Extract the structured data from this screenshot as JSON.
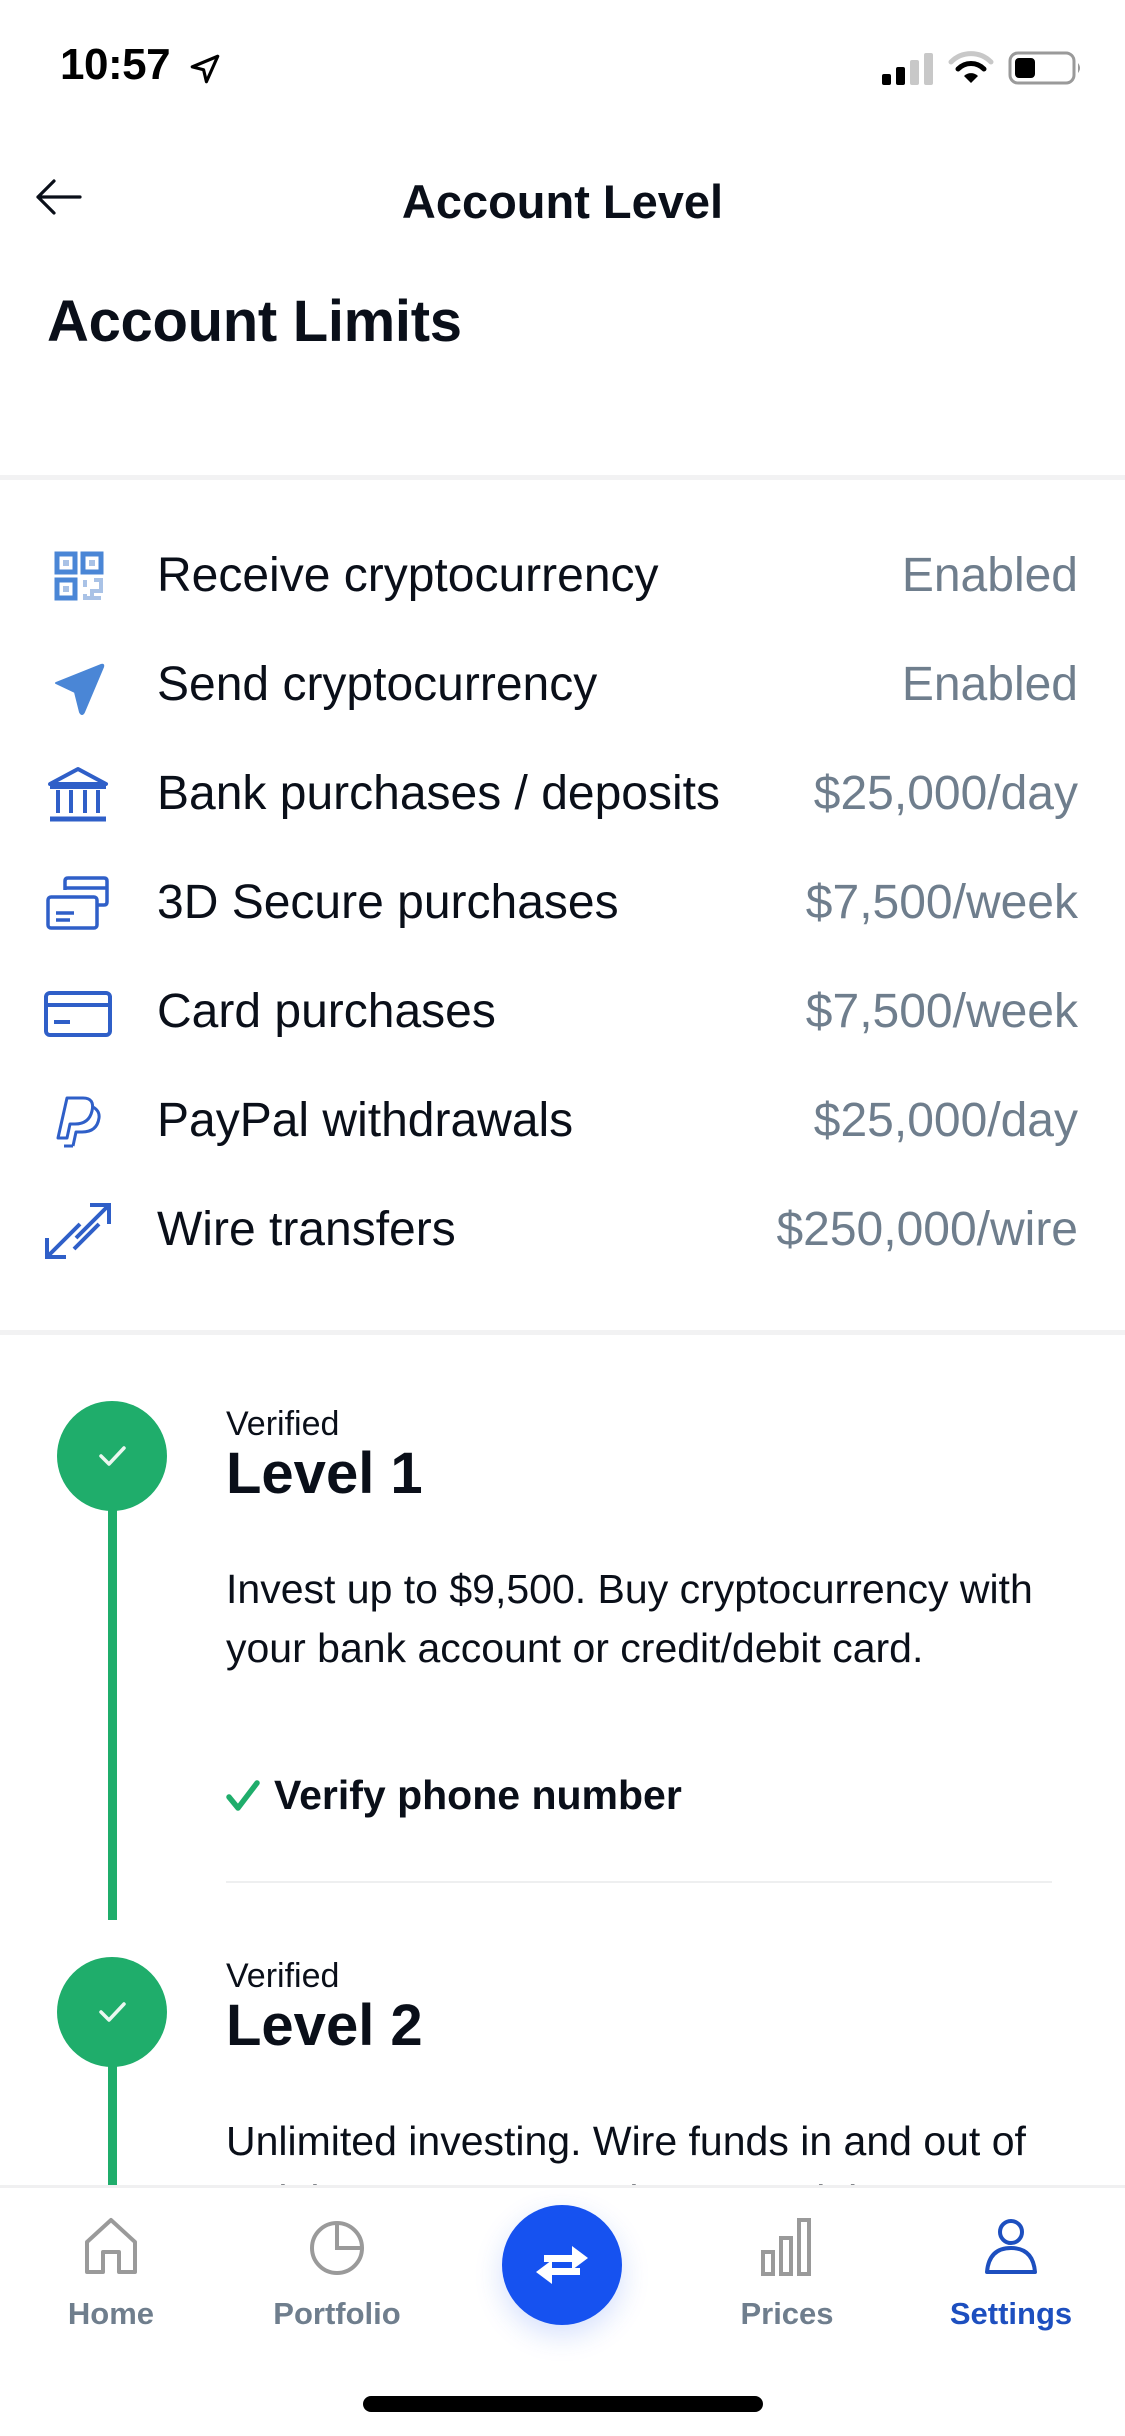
{
  "status_bar": {
    "time": "10:57",
    "signal_bars_active": 2,
    "signal_bars_total": 4,
    "battery_percent": 35
  },
  "header": {
    "back_icon": "arrow-left-icon",
    "title": "Account Level"
  },
  "page_title": "Account Limits",
  "limits": [
    {
      "icon": "qr-code-icon",
      "label": "Receive cryptocurrency",
      "value": "Enabled"
    },
    {
      "icon": "send-plane-icon",
      "label": "Send cryptocurrency",
      "value": "Enabled"
    },
    {
      "icon": "bank-icon",
      "label": "Bank purchases / deposits",
      "value": "$25,000/day"
    },
    {
      "icon": "stacked-cards-icon",
      "label": "3D Secure purchases",
      "value": "$7,500/week"
    },
    {
      "icon": "credit-card-icon",
      "label": "Card purchases",
      "value": "$7,500/week"
    },
    {
      "icon": "paypal-icon",
      "label": "PayPal withdrawals",
      "value": "$25,000/day"
    },
    {
      "icon": "wire-transfer-arrows-icon",
      "label": "Wire transfers",
      "value": "$250,000/wire"
    }
  ],
  "levels": [
    {
      "status": "Verified",
      "title": "Level 1",
      "description": "Invest up to $9,500. Buy cryptocurrency with your bank account or credit/debit card.",
      "requirements": [
        {
          "label": "Verify phone number",
          "done": true
        }
      ]
    },
    {
      "status": "Verified",
      "title": "Level 2",
      "description": "Unlimited investing. Wire funds in and out of Coinbase. Store USD in your Coinbase"
    }
  ],
  "colors": {
    "verified_green": "#1fad6b",
    "brand_blue": "#1652f0",
    "active_tab": "#1d4fbf",
    "muted_text": "#6f7e8d",
    "icon_blue": "#2f5fc8"
  },
  "tab_bar": {
    "tabs": [
      {
        "label": "Home",
        "icon": "home-icon",
        "active": false
      },
      {
        "label": "Portfolio",
        "icon": "pie-chart-icon",
        "active": false
      },
      {
        "label": "Prices",
        "icon": "bar-chart-icon",
        "active": false
      },
      {
        "label": "Settings",
        "icon": "person-icon",
        "active": true
      }
    ],
    "trade_button_icon": "swap-arrows-icon"
  }
}
